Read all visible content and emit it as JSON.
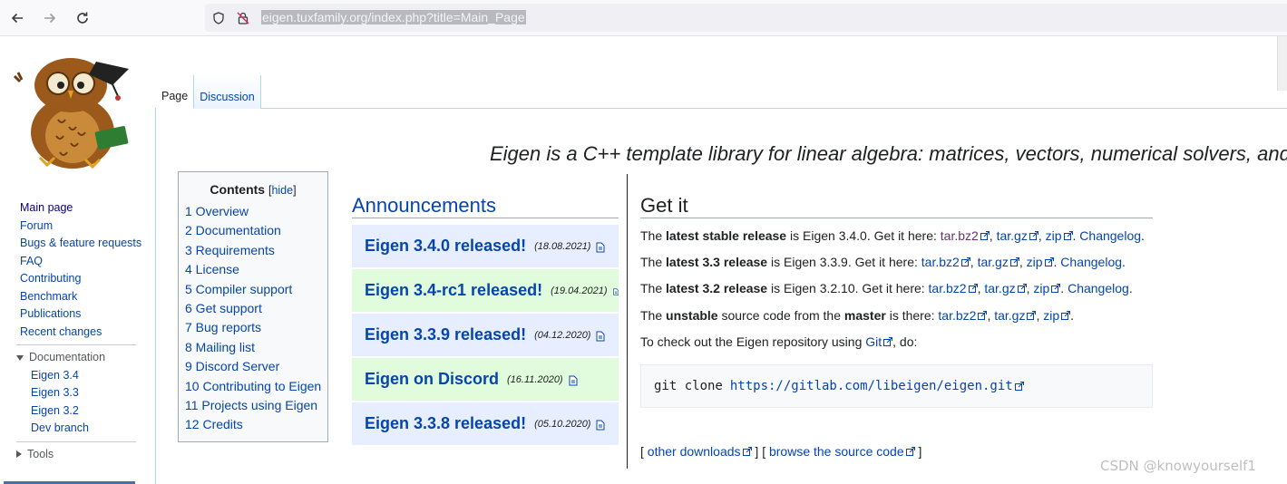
{
  "browser": {
    "url": "eigen.tuxfamily.org/index.php?title=Main_Page",
    "back_icon": "arrow-left-icon",
    "forward_icon": "arrow-right-icon",
    "reload_icon": "reload-icon"
  },
  "sidebar": {
    "nav": [
      {
        "label": "Main page"
      },
      {
        "label": "Forum"
      },
      {
        "label": "Bugs & feature requests"
      },
      {
        "label": "FAQ"
      },
      {
        "label": "Contributing"
      },
      {
        "label": "Benchmark"
      },
      {
        "label": "Publications"
      },
      {
        "label": "Recent changes"
      }
    ],
    "documentation": {
      "label": "Documentation",
      "items": [
        "Eigen 3.4",
        "Eigen 3.3",
        "Eigen 3.2",
        "Dev branch"
      ]
    },
    "tools": {
      "label": "Tools"
    }
  },
  "tabs": [
    "Page",
    "Discussion"
  ],
  "tagline": "Eigen is a C++ template library for linear algebra: matrices, vectors, numerical solvers, and",
  "toc": {
    "title": "Contents",
    "hide_open": "[",
    "hide": "hide",
    "hide_close": "]",
    "items": [
      "1 Overview",
      "2 Documentation",
      "3 Requirements",
      "4 License",
      "5 Compiler support",
      "6 Get support",
      "7 Bug reports",
      "8 Mailing list",
      "9 Discord Server",
      "10 Contributing to Eigen",
      "11 Projects using Eigen",
      "12 Credits"
    ]
  },
  "announcements": {
    "title": "Announcements",
    "items": [
      {
        "title": "Eigen 3.4.0 released!",
        "date": "(18.08.2021)"
      },
      {
        "title": "Eigen 3.4-rc1 released!",
        "date": "(19.04.2021)"
      },
      {
        "title": "Eigen 3.3.9 released!",
        "date": "(04.12.2020)"
      },
      {
        "title": "Eigen on Discord",
        "date": "(16.11.2020)"
      },
      {
        "title": "Eigen 3.3.8 released!",
        "date": "(05.10.2020)"
      }
    ]
  },
  "get_it": {
    "title": "Get it",
    "line1": {
      "pre": "The ",
      "bold": "latest stable release",
      "mid": " is Eigen 3.4.0. Get it here: "
    },
    "line2": {
      "pre": "The ",
      "bold": "latest 3.3 release",
      "mid": " is Eigen 3.3.9. Get it here: "
    },
    "line3": {
      "pre": "The ",
      "bold": "latest 3.2 release",
      "mid": " is Eigen 3.2.10. Get it here: "
    },
    "line4": {
      "pre": "The ",
      "bold": "unstable",
      "mid": " source code from the ",
      "bold2": "master",
      "mid2": " is there: "
    },
    "line5": {
      "pre": "To check out the Eigen repository using ",
      "link": "Git",
      "post": ", do:"
    },
    "links": {
      "tarbz2": "tar.bz2",
      "targz": "tar.gz",
      "zip": "zip",
      "changelog": "Changelog"
    },
    "sep": ", ",
    "dot": ".",
    "code": {
      "cmd": "git clone",
      "url": "https://gitlab.com/libeigen/eigen.git"
    },
    "footer": {
      "open": "[ ",
      "other": "other downloads",
      "mid": " ] [ ",
      "browse": "browse the source code",
      "close": " ]"
    }
  },
  "watermark": "CSDN @knowyourself1",
  "colors": {
    "link": "#0645ad",
    "visited": "#663366",
    "ann_blue": "#e6eeff",
    "ann_green": "#e0fcdc"
  }
}
